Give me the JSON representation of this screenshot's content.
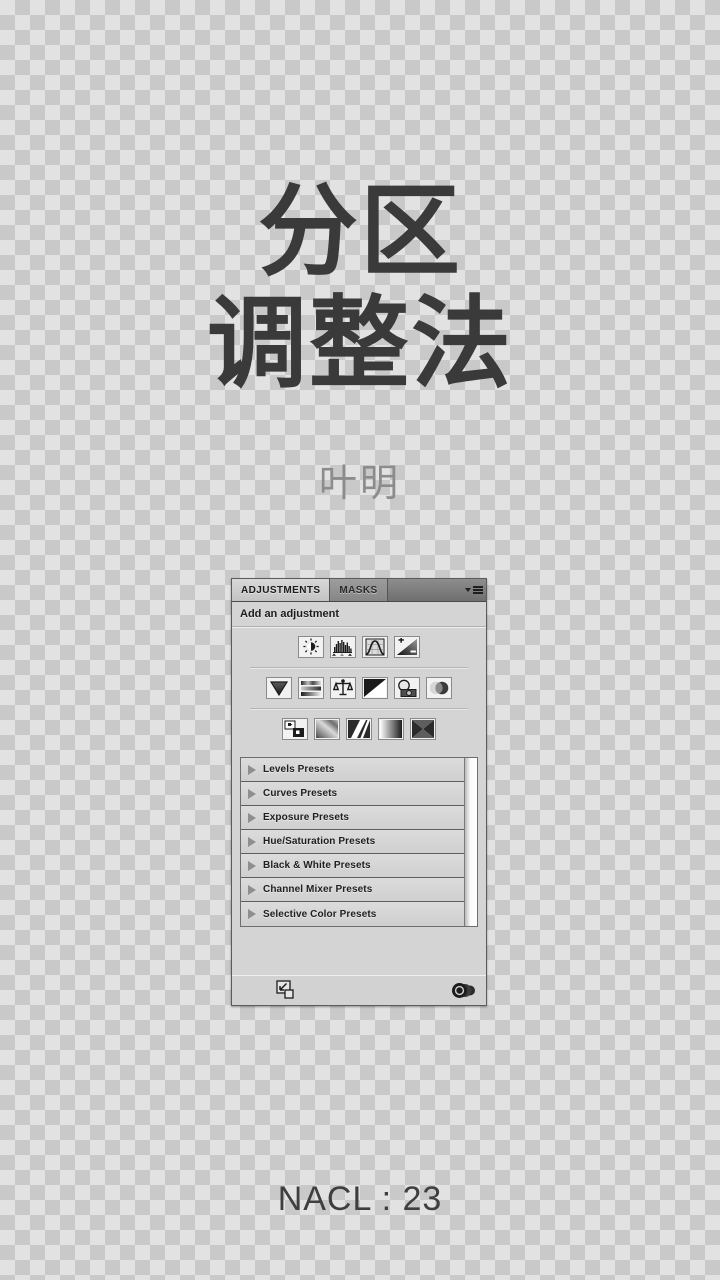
{
  "slide": {
    "title_line_1": "分区",
    "title_line_2": "调整法",
    "author": "叶明",
    "footer": "NACL : 23",
    "title_color": "#3a3a3a",
    "author_color": "#8c8c8c",
    "footer_color": "#3f3f3f",
    "background": "transparent-checkerboard"
  },
  "panel": {
    "tabs": [
      {
        "label": "ADJUSTMENTS",
        "active": true
      },
      {
        "label": "MASKS",
        "active": false
      }
    ],
    "menu_icon": "panel-menu-icon",
    "header_label": "Add an adjustment",
    "adjustment_icons": [
      [
        {
          "name": "brightness-contrast-icon",
          "title": "Brightness/Contrast"
        },
        {
          "name": "levels-icon",
          "title": "Levels"
        },
        {
          "name": "curves-icon",
          "title": "Curves"
        },
        {
          "name": "exposure-icon",
          "title": "Exposure"
        }
      ],
      [
        {
          "name": "vibrance-icon",
          "title": "Vibrance"
        },
        {
          "name": "hue-saturation-icon",
          "title": "Hue/Saturation"
        },
        {
          "name": "color-balance-icon",
          "title": "Color Balance"
        },
        {
          "name": "black-white-icon",
          "title": "Black & White"
        },
        {
          "name": "photo-filter-icon",
          "title": "Photo Filter"
        },
        {
          "name": "channel-mixer-icon",
          "title": "Channel Mixer"
        }
      ],
      [
        {
          "name": "invert-icon",
          "title": "Invert"
        },
        {
          "name": "posterize-icon",
          "title": "Posterize"
        },
        {
          "name": "threshold-icon",
          "title": "Threshold"
        },
        {
          "name": "gradient-map-icon",
          "title": "Gradient Map"
        },
        {
          "name": "selective-color-icon",
          "title": "Selective Color"
        }
      ]
    ],
    "presets": [
      "Levels Presets",
      "Curves Presets",
      "Exposure Presets",
      "Hue/Saturation Presets",
      "Black & White Presets",
      "Channel Mixer Presets",
      "Selective Color Presets"
    ],
    "footer_icons": [
      {
        "name": "clip-to-layer-icon"
      },
      {
        "name": "return-to-adjustment-list-icon"
      }
    ]
  }
}
